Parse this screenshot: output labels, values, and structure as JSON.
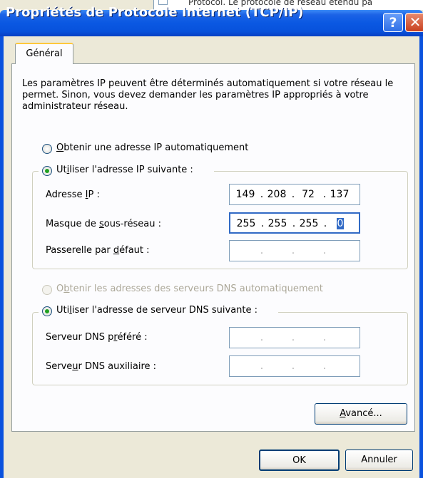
{
  "background_window": {
    "text": "Protocol. Le protocole de réseau étendu pa"
  },
  "title": "Propriétés de Protocole Internet (TCP/IP)",
  "help_glyph": "?",
  "close_glyph": "✕",
  "tab": {
    "label": "Général"
  },
  "description": "Les paramètres IP peuvent être déterminés automatiquement si votre réseau le permet. Sinon, vous devez demander les paramètres IP appropriés à votre administrateur réseau.",
  "ip_mode": {
    "auto": {
      "label_first": "O",
      "label_rest": "btenir une adresse IP automatiquement",
      "checked": false
    },
    "manual": {
      "label_first": "Ut",
      "label_u": "i",
      "label_rest": "liser l'adresse IP suivante :",
      "checked": true
    }
  },
  "fields": {
    "ip": {
      "label_pre": "Adresse ",
      "label_u": "I",
      "label_post": "P :",
      "octets": [
        "149",
        "208",
        "72",
        "137"
      ]
    },
    "mask": {
      "label_pre": "Masque de ",
      "label_u": "s",
      "label_post": "ous-réseau :",
      "octets": [
        "255",
        "255",
        "255",
        ""
      ],
      "selected": "0"
    },
    "gateway": {
      "label_pre": "Passerelle par ",
      "label_u": "d",
      "label_post": "éfaut :",
      "octets": [
        "",
        "",
        "",
        ""
      ]
    }
  },
  "dns_mode": {
    "auto": {
      "label_first": "O",
      "label_u": "b",
      "label_rest": "tenir les adresses des serveurs DNS automatiquement",
      "checked": false,
      "disabled": true
    },
    "manual": {
      "label_first": "Uti",
      "label_u": "l",
      "label_rest": "iser l'adresse de serveur DNS suivante :",
      "checked": true
    }
  },
  "dns": {
    "preferred": {
      "label_pre": "Serveur DNS p",
      "label_u": "r",
      "label_post": "éféré :",
      "octets": [
        "",
        "",
        "",
        ""
      ]
    },
    "alternate": {
      "label_pre": "Serve",
      "label_u": "u",
      "label_post": "r DNS auxiliaire :",
      "octets": [
        "",
        "",
        "",
        ""
      ]
    }
  },
  "buttons": {
    "advanced": {
      "u": "A",
      "rest": "vancé..."
    },
    "ok": "OK",
    "cancel": "Annuler"
  },
  "colors": {
    "titlebar": "#0a58e2",
    "dialog": "#ece9d8",
    "selection": "#316ac5",
    "radio_dot": "#21a121"
  }
}
